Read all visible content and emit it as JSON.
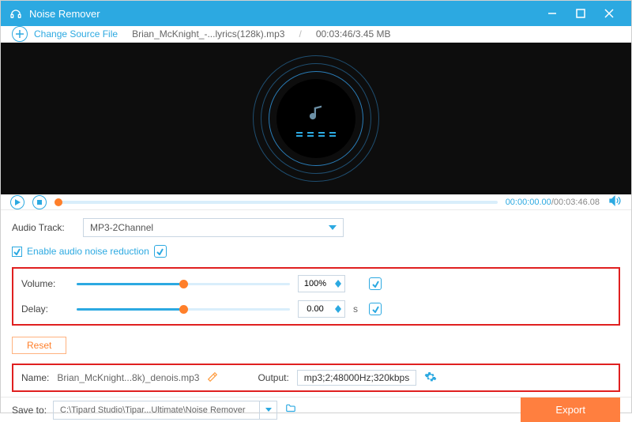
{
  "titlebar": {
    "title": "Noise Remover"
  },
  "source": {
    "change_label": "Change Source File",
    "filename": "Brian_McKnight_-...lyrics(128k).mp3",
    "duration_size": "00:03:46/3.45 MB"
  },
  "playbar": {
    "current": "00:00:00.00",
    "total": "00:03:46.08"
  },
  "audio_track": {
    "label": "Audio Track:",
    "value": "MP3-2Channel"
  },
  "noise": {
    "checkbox_label": "Enable audio noise reduction"
  },
  "volume": {
    "label": "Volume:",
    "value": "100%",
    "percent": 50
  },
  "delay": {
    "label": "Delay:",
    "value": "0.00",
    "unit": "s",
    "percent": 50
  },
  "reset": {
    "label": "Reset"
  },
  "output": {
    "name_label": "Name:",
    "name_value": "Brian_McKnight...8k)_denois.mp3",
    "output_label": "Output:",
    "output_value": "mp3;2;48000Hz;320kbps"
  },
  "footer": {
    "save_label": "Save to:",
    "path": "C:\\Tipard Studio\\Tipar...Ultimate\\Noise Remover",
    "export_label": "Export"
  },
  "colors": {
    "accent": "#2ca9e1",
    "highlight": "#ff7f2a",
    "red": "#e02020"
  }
}
